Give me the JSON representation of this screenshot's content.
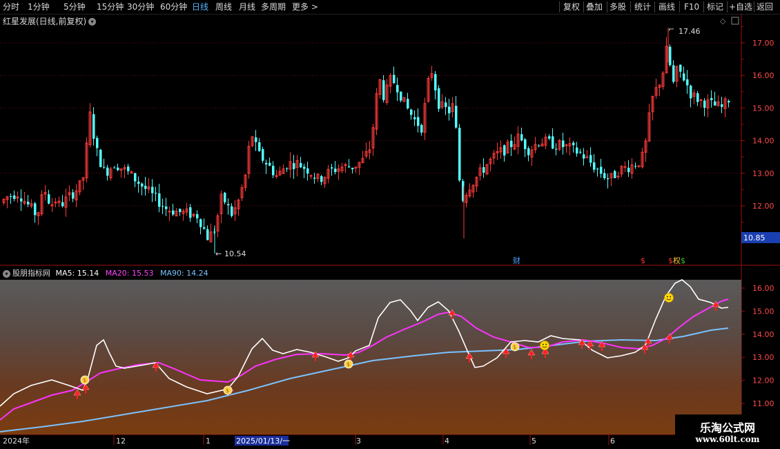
{
  "toolbar": {
    "left_items": [
      "分时",
      "1分钟",
      "5分钟",
      "15分钟",
      "30分钟",
      "60分钟",
      "日线",
      "周线",
      "月线",
      "多周期",
      "更多 >"
    ],
    "active_item": "日线",
    "right_items": [
      "复权",
      "叠加",
      "多股",
      "统计",
      "画线",
      "F10",
      "标记",
      "+自选",
      "返回"
    ]
  },
  "main_chart": {
    "title": "红星发展(日线,前复权)",
    "price_axis": [
      "17.00",
      "16.00",
      "15.00",
      "14.00",
      "13.00",
      "12.00"
    ],
    "current_price": "10.85",
    "high_label": "17.46",
    "low_label": "10.54",
    "event_markers": [
      "财",
      "$",
      "权"
    ]
  },
  "indicator": {
    "name": "股朋指标网",
    "ma5_label": "MA5:",
    "ma5": "15.14",
    "ma20_label": "MA20:",
    "ma20": "15.53",
    "ma90_label": "MA90:",
    "ma90": "14.24",
    "axis": [
      "16.00",
      "15.00",
      "14.00",
      "13.00",
      "12.00",
      "11.00"
    ],
    "colors": {
      "ma5": "#ffffff",
      "ma20": "#ff33ff",
      "ma90": "#7ac3ff"
    }
  },
  "time_axis": {
    "labels": [
      "2024年",
      "12",
      "1",
      "2025/01/13/一",
      "3",
      "4",
      "5",
      "6"
    ]
  },
  "watermark": {
    "line1": "乐淘公式网",
    "line2": "www.60lt.com"
  },
  "chart_data": {
    "type": "candlestick",
    "y_range": [
      10.4,
      17.8
    ],
    "up_color": "#ff3b3b",
    "down_color": "#54ffff",
    "high": 17.46,
    "low": 10.54
  }
}
